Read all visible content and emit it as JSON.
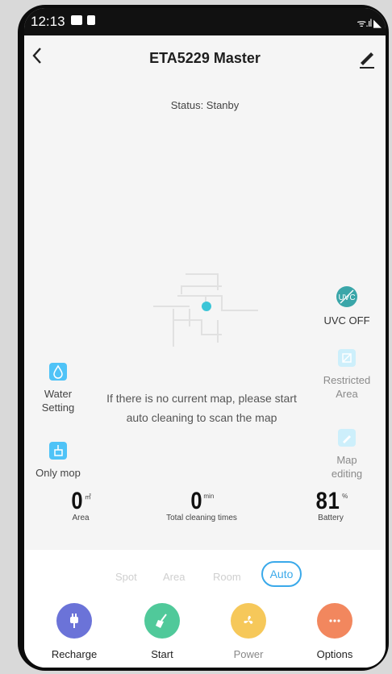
{
  "statusbar": {
    "time": "12:13",
    "right": "ᯤ.ıl ◣"
  },
  "header": {
    "back_label": "‹",
    "title": "ETA5229 Master"
  },
  "status_text": "Status: Stanby",
  "right_controls": {
    "uvc": {
      "icon": "uvc-icon",
      "label": "UVC OFF",
      "color": "#3aa6a9"
    },
    "restricted": {
      "label_lines": [
        "Restricted",
        "Area"
      ],
      "color": "#6fd0f5"
    },
    "map_edit": {
      "label_lines": [
        "Map",
        "editing"
      ],
      "color": "#6fd0f5"
    }
  },
  "left_controls": {
    "water": {
      "label_lines": [
        "Water",
        "Setting"
      ],
      "color": "#4fc3f7"
    },
    "mop": {
      "label": "Only mop",
      "color": "#4fc3f7"
    }
  },
  "hint_lines": [
    "If there is no current map, please start",
    "auto cleaning to scan the map"
  ],
  "stats": [
    {
      "value": "0",
      "unit": "㎡",
      "label": "Area"
    },
    {
      "value": "0",
      "unit": "min",
      "label": "Total cleaning times"
    },
    {
      "value": "81",
      "unit": "%",
      "label": "Battery"
    }
  ],
  "modes": [
    "Spot",
    "Area",
    "Room",
    "Auto"
  ],
  "active_mode": "Auto",
  "actions": [
    {
      "label": "Recharge",
      "icon": "plug-icon",
      "color": "#6b73d8"
    },
    {
      "label": "Start",
      "icon": "broom-icon",
      "color": "#50c99a"
    },
    {
      "label": "Power",
      "icon": "fan-icon",
      "color": "#f6c85a"
    },
    {
      "label": "Options",
      "icon": "more-icon",
      "color": "#f2875e"
    }
  ]
}
